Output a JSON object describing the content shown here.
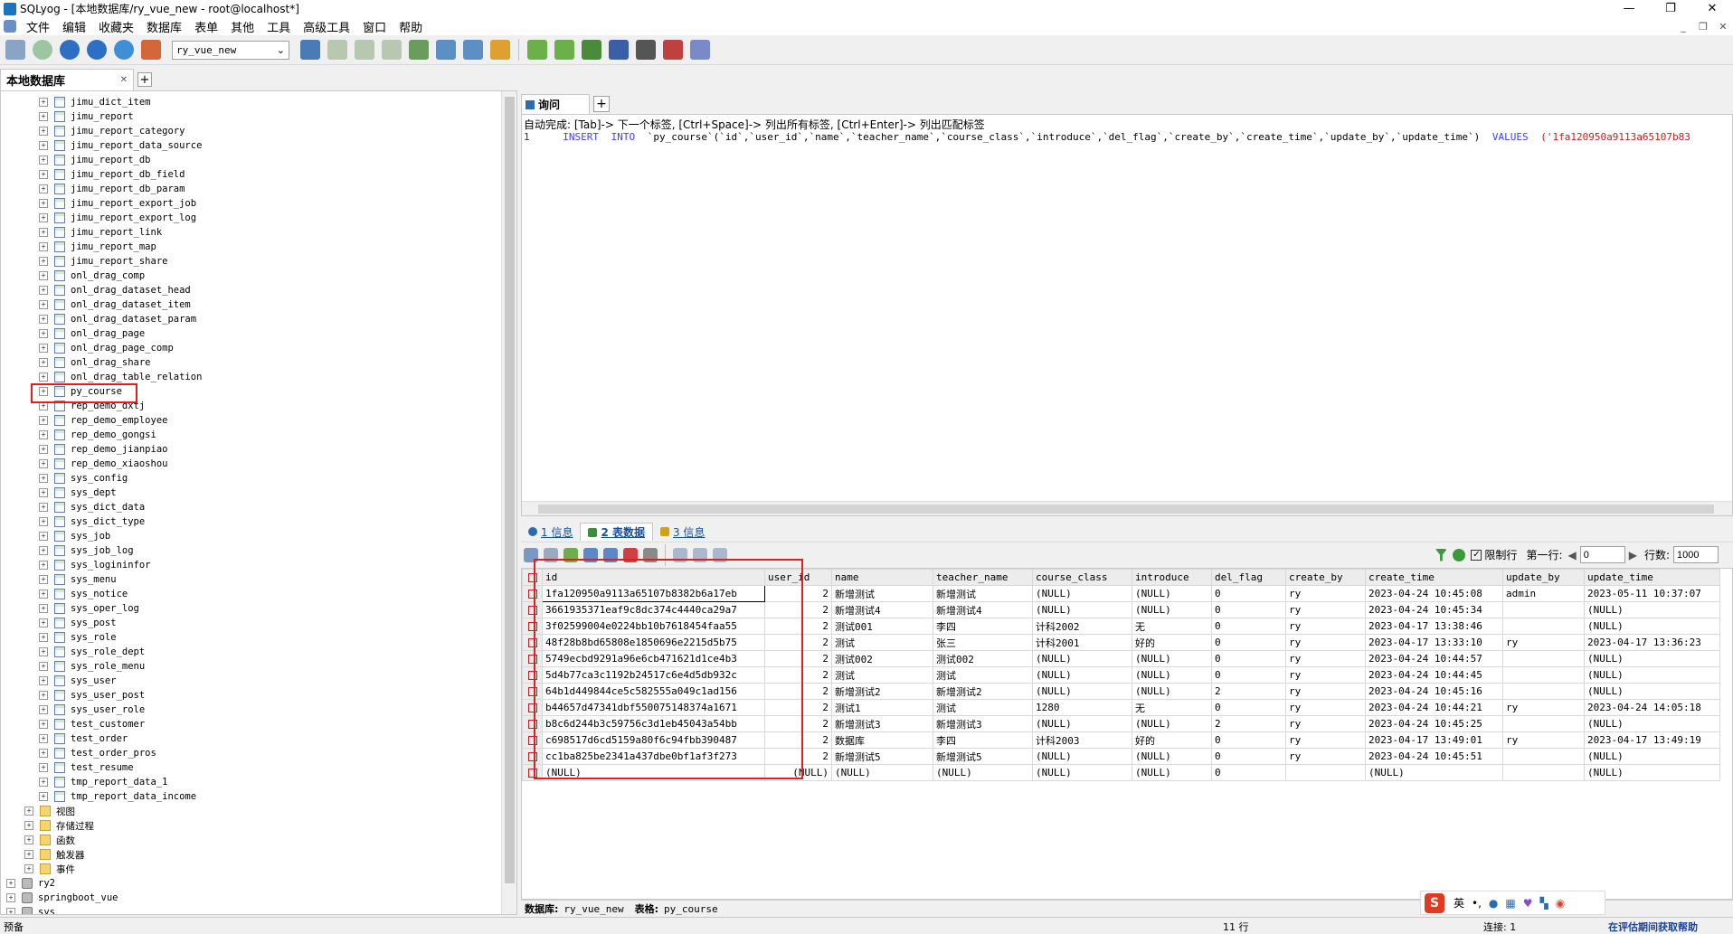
{
  "window": {
    "title": "SQLyog - [本地数据库/ry_vue_new - root@localhost*]",
    "controls": [
      "—",
      "❐",
      "✕"
    ]
  },
  "menu": {
    "items": [
      "文件",
      "编辑",
      "收藏夹",
      "数据库",
      "表单",
      "其他",
      "工具",
      "高级工具",
      "窗口",
      "帮助"
    ],
    "mdi": [
      "_",
      "❐",
      "✕"
    ]
  },
  "toolbar": {
    "db_selected": "ry_vue_new"
  },
  "left_tab": {
    "label": "本地数据库",
    "close": "✕",
    "add": "+"
  },
  "tree": {
    "tables": [
      "jimu_dict_item",
      "jimu_report",
      "jimu_report_category",
      "jimu_report_data_source",
      "jimu_report_db",
      "jimu_report_db_field",
      "jimu_report_db_param",
      "jimu_report_export_job",
      "jimu_report_export_log",
      "jimu_report_link",
      "jimu_report_map",
      "jimu_report_share",
      "onl_drag_comp",
      "onl_drag_dataset_head",
      "onl_drag_dataset_item",
      "onl_drag_dataset_param",
      "onl_drag_page",
      "onl_drag_page_comp",
      "onl_drag_share",
      "onl_drag_table_relation",
      "py_course",
      "rep_demo_dxtj",
      "rep_demo_employee",
      "rep_demo_gongsi",
      "rep_demo_jianpiao",
      "rep_demo_xiaoshou",
      "sys_config",
      "sys_dept",
      "sys_dict_data",
      "sys_dict_type",
      "sys_job",
      "sys_job_log",
      "sys_logininfor",
      "sys_menu",
      "sys_notice",
      "sys_oper_log",
      "sys_post",
      "sys_role",
      "sys_role_dept",
      "sys_role_menu",
      "sys_user",
      "sys_user_post",
      "sys_user_role",
      "test_customer",
      "test_order",
      "test_order_pros",
      "test_resume",
      "tmp_report_data_1",
      "tmp_report_data_income"
    ],
    "folders": [
      "视图",
      "存储过程",
      "函数",
      "触发器",
      "事件"
    ],
    "databases": [
      "ry2",
      "springboot_vue",
      "sys"
    ],
    "expander": "+"
  },
  "query_tab": {
    "label": "询问",
    "add": "+"
  },
  "editor": {
    "hint": "自动完成: [Tab]-> 下一个标签, [Ctrl+Space]-> 列出所有标签, [Ctrl+Enter]-> 列出匹配标签",
    "line_no": "1",
    "kw_insert": "INSERT",
    "kw_into": "INTO",
    "sql_columns": "`py_course`(`id`,`user_id`,`name`,`teacher_name`,`course_class`,`introduce`,`del_flag`,`create_by`,`create_time`,`update_by`,`update_time`)",
    "kw_values": "VALUES",
    "sql_values": "('1fa120950a9113a65107b83"
  },
  "result_tabs": [
    {
      "label": "1 信息",
      "color": "#2b6cb0"
    },
    {
      "label": "2 表数据",
      "color": "#3c8d3c"
    },
    {
      "label": "3 信息",
      "color": "#d4a017"
    }
  ],
  "pager": {
    "limit_label": "限制行",
    "limit_checked": "✓",
    "first_row_label": "第一行:",
    "first_row": "0",
    "rows_label": "行数:",
    "rows": "1000"
  },
  "grid": {
    "columns": [
      "id",
      "user_id",
      "name",
      "teacher_name",
      "course_class",
      "introduce",
      "del_flag",
      "create_by",
      "create_time",
      "update_by",
      "update_time"
    ],
    "rows": [
      [
        "1fa120950a9113a65107b8382b6a17eb",
        "2",
        "新增测试",
        "新增测试",
        "(NULL)",
        "(NULL)",
        "0",
        "ry",
        "2023-04-24 10:45:08",
        "admin",
        "2023-05-11 10:37:07"
      ],
      [
        "3661935371eaf9c8dc374c4440ca29a7",
        "2",
        "新增测试4",
        "新增测试4",
        "(NULL)",
        "(NULL)",
        "0",
        "ry",
        "2023-04-24 10:45:34",
        "",
        "(NULL)"
      ],
      [
        "3f02599004e0224bb10b7618454faa55",
        "2",
        "测试001",
        "李四",
        "计科2002",
        "无",
        "0",
        "ry",
        "2023-04-17 13:38:46",
        "",
        "(NULL)"
      ],
      [
        "48f28b8bd65808e1850696e2215d5b75",
        "2",
        "测试",
        "张三",
        "计科2001",
        "好的",
        "0",
        "ry",
        "2023-04-17 13:33:10",
        "ry",
        "2023-04-17 13:36:23"
      ],
      [
        "5749ecbd9291a96e6cb471621d1ce4b3",
        "2",
        "测试002",
        "测试002",
        "(NULL)",
        "(NULL)",
        "0",
        "ry",
        "2023-04-24 10:44:57",
        "",
        "(NULL)"
      ],
      [
        "5d4b77ca3c1192b24517c6e4d5db932c",
        "2",
        "测试",
        "测试",
        "(NULL)",
        "(NULL)",
        "0",
        "ry",
        "2023-04-24 10:44:45",
        "",
        "(NULL)"
      ],
      [
        "64b1d449844ce5c582555a049c1ad156",
        "2",
        "新增测试2",
        "新增测试2",
        "(NULL)",
        "(NULL)",
        "2",
        "ry",
        "2023-04-24 10:45:16",
        "",
        "(NULL)"
      ],
      [
        "b44657d47341dbf550075148374a1671",
        "2",
        "测试1",
        "测试",
        "1280",
        "无",
        "0",
        "ry",
        "2023-04-24 10:44:21",
        "ry",
        "2023-04-24 14:05:18"
      ],
      [
        "b8c6d244b3c59756c3d1eb45043a54bb",
        "2",
        "新增测试3",
        "新增测试3",
        "(NULL)",
        "(NULL)",
        "2",
        "ry",
        "2023-04-24 10:45:25",
        "",
        "(NULL)"
      ],
      [
        "c698517d6cd5159a80f6c94fbb390487",
        "2",
        "数据库",
        "李四",
        "计科2003",
        "好的",
        "0",
        "ry",
        "2023-04-17 13:49:01",
        "ry",
        "2023-04-17 13:49:19"
      ],
      [
        "cc1ba825be2341a437dbe0bf1af3f273",
        "2",
        "新增测试5",
        "新增测试5",
        "(NULL)",
        "(NULL)",
        "0",
        "ry",
        "2023-04-24 10:45:51",
        "",
        "(NULL)"
      ],
      [
        "(NULL)",
        "(NULL)",
        "(NULL)",
        "(NULL)",
        "(NULL)",
        "(NULL)",
        "0",
        "",
        "(NULL)",
        "",
        "(NULL)"
      ]
    ]
  },
  "status_line": {
    "db_label": "数据库:",
    "db": "ry_vue_new",
    "table_label": "表格:",
    "table": "py_course"
  },
  "ime": {
    "logo": "S",
    "lang": "英",
    "punct": "•,"
  },
  "statusbar": {
    "ready": "预备",
    "rows": "11 行",
    "conn": "连接: 1",
    "promo": "在评估期间获取帮助"
  }
}
